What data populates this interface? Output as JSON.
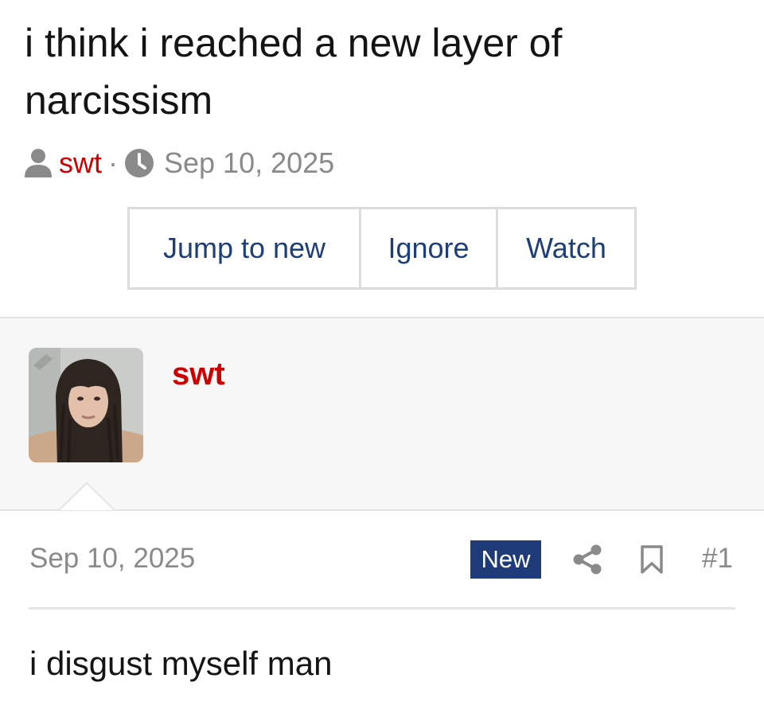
{
  "thread": {
    "title": "i think i reached a new layer of narcissism",
    "author": "swt",
    "separator": "·",
    "date": "Sep 10, 2025"
  },
  "actions": {
    "jump_label": "Jump to new",
    "ignore_label": "Ignore",
    "watch_label": "Watch"
  },
  "post": {
    "username": "swt",
    "date": "Sep 10, 2025",
    "badge": "New",
    "number": "#1",
    "body": "i disgust myself man"
  },
  "colors": {
    "accent_red": "#cc0000",
    "link_blue": "#1e3e78",
    "badge_bg": "#1e3a78",
    "muted": "#8a8a8a"
  },
  "icons": {
    "author": "user-icon",
    "date": "clock-icon",
    "share": "share-icon",
    "bookmark": "bookmark-icon"
  }
}
